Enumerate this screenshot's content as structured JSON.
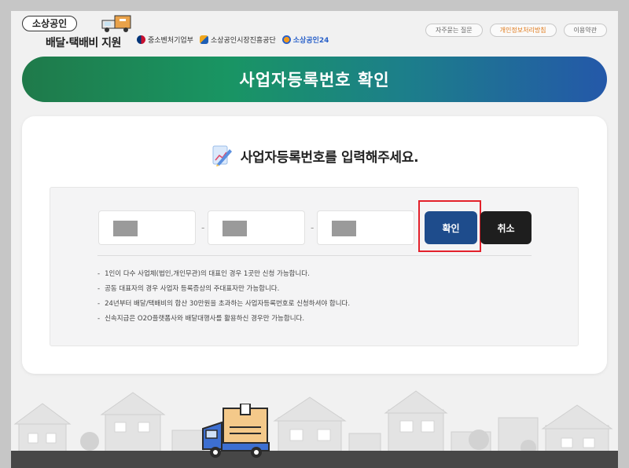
{
  "header": {
    "logo_top": "소상공인",
    "logo_sub": "배달·택배비 지원",
    "orgs": [
      "중소벤처기업부",
      "소상공인시장진흥공단",
      "소상공인24"
    ],
    "links": [
      "자주묻는 질문",
      "개인정보처리방침",
      "이용약관"
    ]
  },
  "banner": {
    "title": "사업자등록번호 확인"
  },
  "form": {
    "prompt": "사업자등록번호를 입력해주세요.",
    "separator": "-",
    "confirm_label": "확인",
    "cancel_label": "취소",
    "notes": [
      "1인이 다수 사업체(법인,개인무관)의 대표인 경우 1곳만 신청 가능합니다.",
      "공동 대표자의 경우 사업자 등록증상의 주대표자만 가능합니다.",
      "24년부터 배달/택배비의 합산 30만원을 초과하는 사업자등록번호로 신청하셔야 합니다.",
      "신속지급은 O2O플랫폼사와 배달대행사를 활용하신 경우만 가능합니다."
    ]
  },
  "colors": {
    "confirm": "#1e4c8c",
    "cancel": "#1e1e1e",
    "highlight": "#e3212b",
    "banner_start": "#1f7a4a",
    "banner_end": "#2458a9"
  },
  "icons": [
    "truck-icon",
    "pencil-document-icon",
    "delivery-box-icon"
  ]
}
